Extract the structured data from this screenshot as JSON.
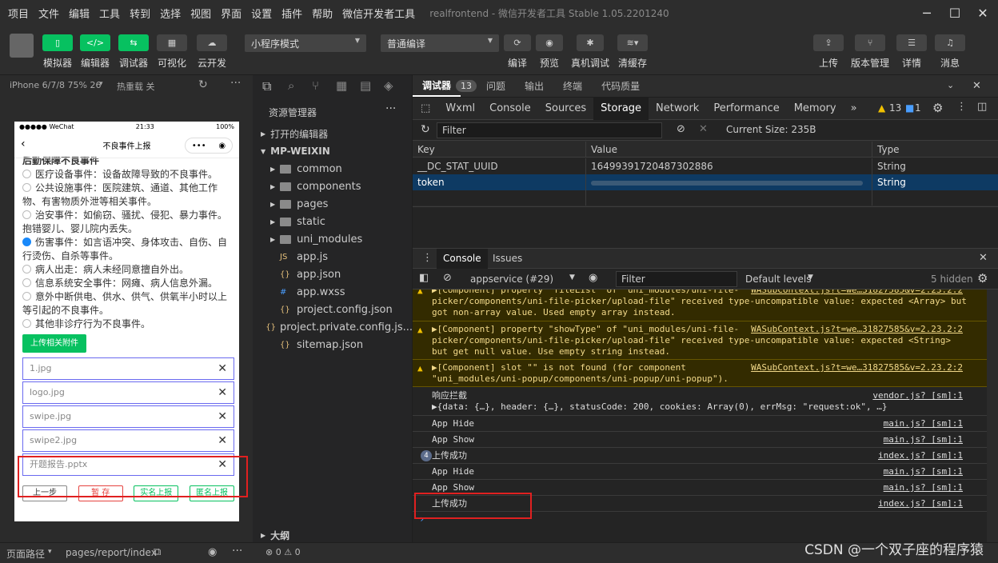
{
  "menu": [
    "项目",
    "文件",
    "编辑",
    "工具",
    "转到",
    "选择",
    "视图",
    "界面",
    "设置",
    "插件",
    "帮助",
    "微信开发者工具"
  ],
  "window_title": "realfrontend - 微信开发者工具 Stable 1.05.2201240",
  "toolbar": {
    "left_buttons": [
      {
        "label": "模拟器",
        "icon": "phone-icon"
      },
      {
        "label": "编辑器",
        "icon": "code-icon"
      },
      {
        "label": "调试器",
        "icon": "debug-icon"
      },
      {
        "label": "可视化",
        "icon": "grid-icon"
      },
      {
        "label": "云开发",
        "icon": "cloud-icon"
      }
    ],
    "mode_select": "小程序模式",
    "compile_select": "普通编译",
    "mid_buttons": [
      "编译",
      "预览",
      "真机调试",
      "清缓存"
    ],
    "right_buttons": [
      "上传",
      "版本管理",
      "详情",
      "消息"
    ]
  },
  "sim": {
    "device": "iPhone 6/7/8 75% 26",
    "reload": "热重载 关",
    "status_left": "●●●●● WeChat",
    "status_time": "21:33",
    "status_right": "100%",
    "nav_title": "不良事件上报",
    "section_title": "后勤保障不良事件",
    "options": [
      {
        "text": "医疗设备事件：设备故障导致的不良事件。",
        "checked": false
      },
      {
        "text": "公共设施事件：医院建筑、通道、其他工作物、有害物质外泄等相关事件。",
        "checked": false
      },
      {
        "text": "治安事件：如偷窃、骚扰、侵犯、暴力事件。抱错婴儿、婴儿院内丢失。",
        "checked": false
      },
      {
        "text": "伤害事件：如言语冲突、身体攻击、自伤、自行烫伤、自杀等事件。",
        "checked": true
      },
      {
        "text": "病人出走：病人未经同意擅自外出。",
        "checked": false
      },
      {
        "text": "信息系统安全事件：网瘫、病人信息外漏。",
        "checked": false
      },
      {
        "text": "意外中断供电、供水、供气、供氧半小时以上等引起的不良事件。",
        "checked": false
      },
      {
        "text": "其他非诊疗行为不良事件。",
        "checked": false
      }
    ],
    "upload_button": "上传相关附件",
    "files": [
      "1.jpg",
      "logo.jpg",
      "swipe.jpg",
      "swipe2.jpg",
      "开题报告.pptx"
    ],
    "bottom_buttons": [
      "上一步",
      "暂 存",
      "实名上报",
      "匿名上报"
    ]
  },
  "explorer": {
    "title": "资源管理器",
    "open_editors": "打开的编辑器",
    "project": "MP-WEIXIN",
    "items": [
      {
        "name": "common",
        "type": "folder"
      },
      {
        "name": "components",
        "type": "folder"
      },
      {
        "name": "pages",
        "type": "folder"
      },
      {
        "name": "static",
        "type": "folder"
      },
      {
        "name": "uni_modules",
        "type": "folder"
      },
      {
        "name": "app.js",
        "type": "js"
      },
      {
        "name": "app.json",
        "type": "json"
      },
      {
        "name": "app.wxss",
        "type": "wxss"
      },
      {
        "name": "project.config.json",
        "type": "json"
      },
      {
        "name": "project.private.config.js...",
        "type": "json"
      },
      {
        "name": "sitemap.json",
        "type": "json"
      }
    ],
    "outline": "大纲"
  },
  "devtools": {
    "top_tabs": [
      "调试器",
      "13",
      "问题",
      "输出",
      "终端",
      "代码质量"
    ],
    "tabs": [
      "Wxml",
      "Console",
      "Sources",
      "Storage",
      "Network",
      "Performance",
      "Memory"
    ],
    "active_tab": "Storage",
    "warn_count": "13",
    "err_count": "1",
    "filter_placeholder": "Filter",
    "current_size": "Current Size: 235B",
    "storage_headers": [
      "Key",
      "Value",
      "Type"
    ],
    "storage_rows": [
      {
        "key": "__DC_STAT_UUID",
        "value": "16499391720487302886",
        "type": "String"
      },
      {
        "key": "token",
        "value": "",
        "type": "String"
      }
    ]
  },
  "console": {
    "tabs": [
      "Console",
      "Issues"
    ],
    "context": "appservice (#29)",
    "filter_placeholder": "Filter",
    "levels": "Default levels",
    "hidden": "5 hidden",
    "lines": [
      {
        "kind": "warn",
        "text": "▶[Component] property \"fileList\" of \"uni_modules/uni-file-\npicker/components/uni-file-picker/upload-file\" received type-uncompatible value: expected <Array> but\ngot non-array value. Used empty array instead.",
        "src": "WASubContext.js?t=we…31827585&v=2.23.2:2"
      },
      {
        "kind": "warn",
        "text": "▶[Component] property \"showType\" of \"uni_modules/uni-file-\npicker/components/uni-file-picker/upload-file\" received type-uncompatible value: expected <String>\nbut get null value. Use empty string instead.",
        "src": "WASubContext.js?t=we…31827585&v=2.23.2:2"
      },
      {
        "kind": "warn",
        "text": "▶[Component] slot \"\" is not found (for component\n\"uni_modules/uni-popup/components/uni-popup/uni-popup\").",
        "src": "WASubContext.js?t=we…31827585&v=2.23.2:2"
      },
      {
        "kind": "log",
        "text": "响应拦截\n▶{data: {…}, header: {…}, statusCode: 200, cookies: Array(0), errMsg: \"request:ok\", …}",
        "src": "vendor.js? [sm]:1"
      },
      {
        "kind": "log",
        "text": "App Hide",
        "src": "main.js? [sm]:1"
      },
      {
        "kind": "log",
        "text": "App Show",
        "src": "main.js? [sm]:1"
      },
      {
        "kind": "log",
        "text": "上传成功",
        "src": "index.js? [sm]:1",
        "badge": "4"
      },
      {
        "kind": "log",
        "text": "App Hide",
        "src": "main.js? [sm]:1"
      },
      {
        "kind": "log",
        "text": "App Show",
        "src": "main.js? [sm]:1"
      },
      {
        "kind": "log",
        "text": "上传成功",
        "src": "index.js? [sm]:1"
      }
    ]
  },
  "footer": {
    "path_label": "页面路径",
    "path": "pages/report/index",
    "status": "⊗ 0 ⚠ 0"
  },
  "watermark": "CSDN @一个双子座的程序猿"
}
